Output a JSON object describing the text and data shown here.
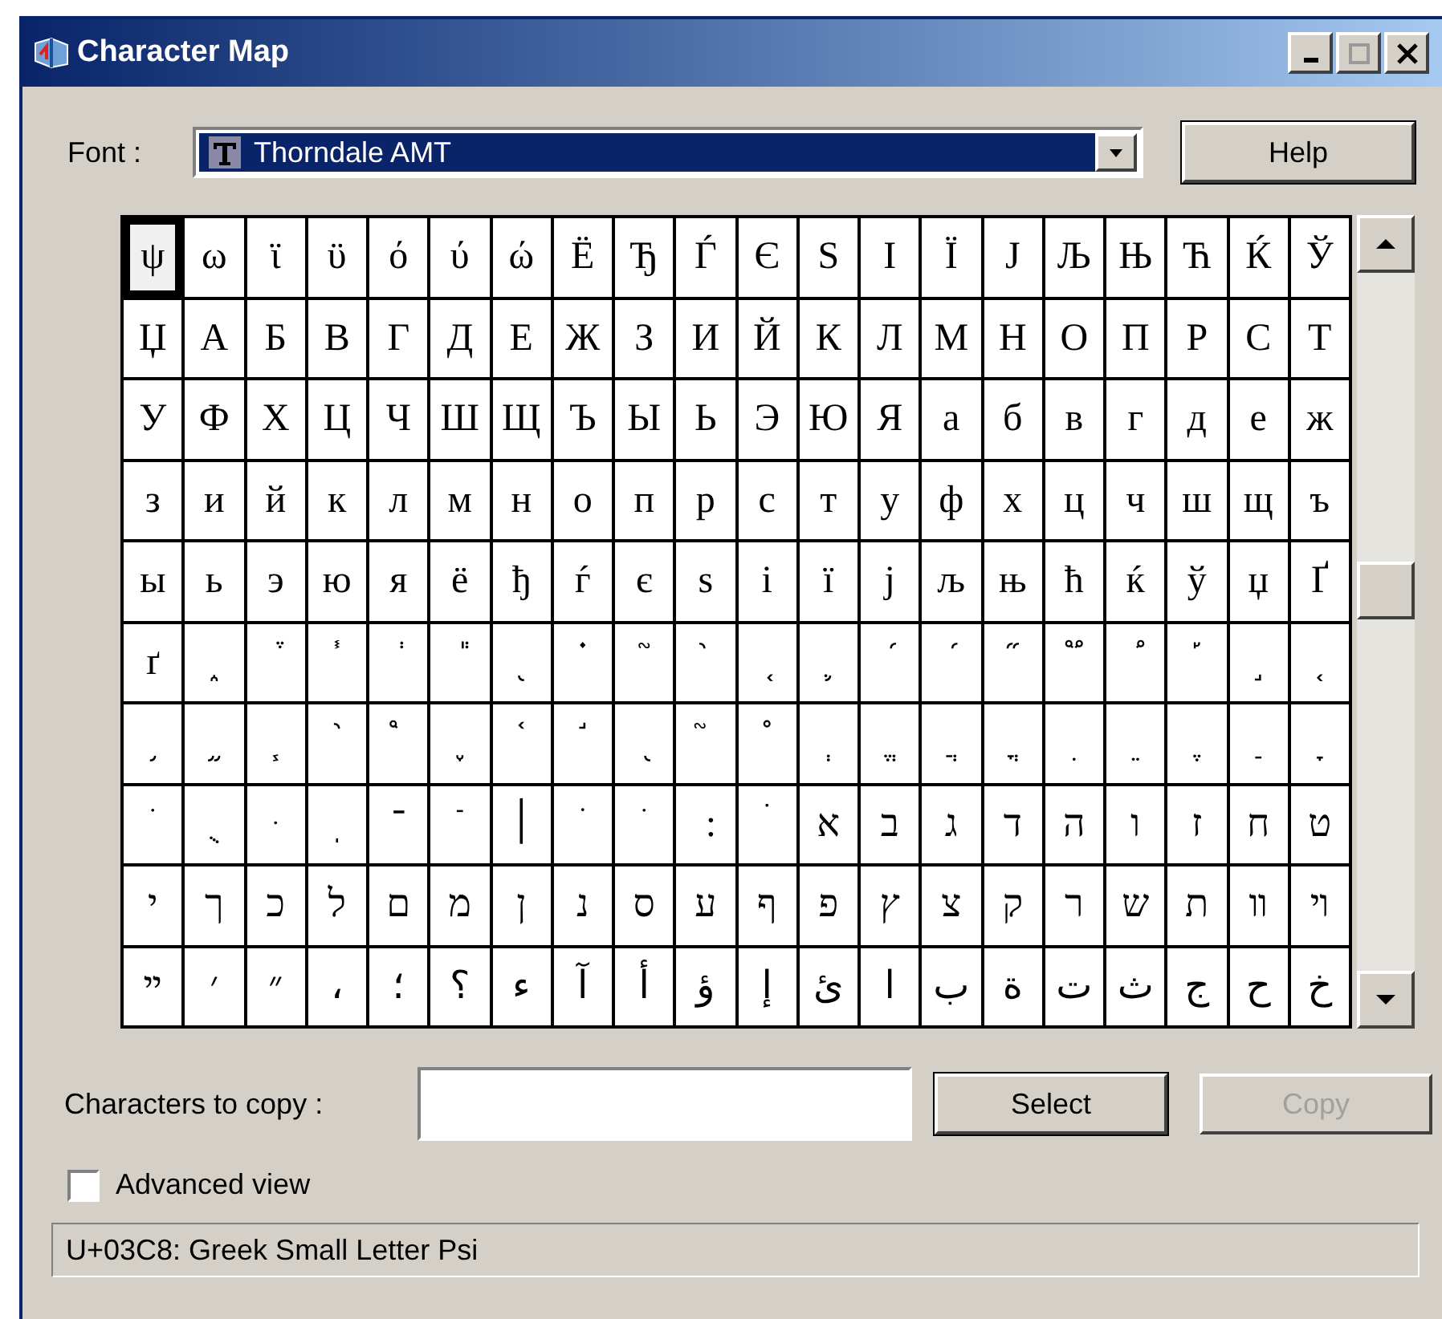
{
  "window": {
    "title": "Character Map"
  },
  "font": {
    "label": "Font :",
    "value": "Thorndale AMT"
  },
  "help_button": {
    "label": "Help"
  },
  "grid": {
    "rows": [
      {
        "cells": [
          {
            "char": "ψ",
            "selected": true
          },
          {
            "char": "ω",
            "selected": false
          },
          {
            "char": "ϊ",
            "selected": false
          },
          {
            "char": "ϋ",
            "selected": false
          },
          {
            "char": "ό",
            "selected": false
          },
          {
            "char": "ύ",
            "selected": false
          },
          {
            "char": "ώ",
            "selected": false
          },
          {
            "char": "Ё",
            "selected": false
          },
          {
            "char": "Ђ",
            "selected": false
          },
          {
            "char": "Ѓ",
            "selected": false
          },
          {
            "char": "Є",
            "selected": false
          },
          {
            "char": "Ѕ",
            "selected": false
          },
          {
            "char": "І",
            "selected": false
          },
          {
            "char": "Ї",
            "selected": false
          },
          {
            "char": "Ј",
            "selected": false
          },
          {
            "char": "Љ",
            "selected": false
          },
          {
            "char": "Њ",
            "selected": false
          },
          {
            "char": "Ћ",
            "selected": false
          },
          {
            "char": "Ќ",
            "selected": false
          },
          {
            "char": "Ў",
            "selected": false
          }
        ]
      },
      {
        "cells": [
          {
            "char": "Џ",
            "selected": false
          },
          {
            "char": "А",
            "selected": false
          },
          {
            "char": "Б",
            "selected": false
          },
          {
            "char": "В",
            "selected": false
          },
          {
            "char": "Г",
            "selected": false
          },
          {
            "char": "Д",
            "selected": false
          },
          {
            "char": "Е",
            "selected": false
          },
          {
            "char": "Ж",
            "selected": false
          },
          {
            "char": "З",
            "selected": false
          },
          {
            "char": "И",
            "selected": false
          },
          {
            "char": "Й",
            "selected": false
          },
          {
            "char": "К",
            "selected": false
          },
          {
            "char": "Л",
            "selected": false
          },
          {
            "char": "М",
            "selected": false
          },
          {
            "char": "Н",
            "selected": false
          },
          {
            "char": "О",
            "selected": false
          },
          {
            "char": "П",
            "selected": false
          },
          {
            "char": "Р",
            "selected": false
          },
          {
            "char": "С",
            "selected": false
          },
          {
            "char": "Т",
            "selected": false
          }
        ]
      },
      {
        "cells": [
          {
            "char": "У",
            "selected": false
          },
          {
            "char": "Ф",
            "selected": false
          },
          {
            "char": "Х",
            "selected": false
          },
          {
            "char": "Ц",
            "selected": false
          },
          {
            "char": "Ч",
            "selected": false
          },
          {
            "char": "Ш",
            "selected": false
          },
          {
            "char": "Щ",
            "selected": false
          },
          {
            "char": "Ъ",
            "selected": false
          },
          {
            "char": "Ы",
            "selected": false
          },
          {
            "char": "Ь",
            "selected": false
          },
          {
            "char": "Э",
            "selected": false
          },
          {
            "char": "Ю",
            "selected": false
          },
          {
            "char": "Я",
            "selected": false
          },
          {
            "char": "а",
            "selected": false
          },
          {
            "char": "б",
            "selected": false
          },
          {
            "char": "в",
            "selected": false
          },
          {
            "char": "г",
            "selected": false
          },
          {
            "char": "д",
            "selected": false
          },
          {
            "char": "е",
            "selected": false
          },
          {
            "char": "ж",
            "selected": false
          }
        ]
      },
      {
        "cells": [
          {
            "char": "з",
            "selected": false
          },
          {
            "char": "и",
            "selected": false
          },
          {
            "char": "й",
            "selected": false
          },
          {
            "char": "к",
            "selected": false
          },
          {
            "char": "л",
            "selected": false
          },
          {
            "char": "м",
            "selected": false
          },
          {
            "char": "н",
            "selected": false
          },
          {
            "char": "о",
            "selected": false
          },
          {
            "char": "п",
            "selected": false
          },
          {
            "char": "р",
            "selected": false
          },
          {
            "char": "с",
            "selected": false
          },
          {
            "char": "т",
            "selected": false
          },
          {
            "char": "у",
            "selected": false
          },
          {
            "char": "ф",
            "selected": false
          },
          {
            "char": "х",
            "selected": false
          },
          {
            "char": "ц",
            "selected": false
          },
          {
            "char": "ч",
            "selected": false
          },
          {
            "char": "ш",
            "selected": false
          },
          {
            "char": "щ",
            "selected": false
          },
          {
            "char": "ъ",
            "selected": false
          }
        ]
      },
      {
        "cells": [
          {
            "char": "ы",
            "selected": false
          },
          {
            "char": "ь",
            "selected": false
          },
          {
            "char": "э",
            "selected": false
          },
          {
            "char": "ю",
            "selected": false
          },
          {
            "char": "я",
            "selected": false
          },
          {
            "char": "ё",
            "selected": false
          },
          {
            "char": "ђ",
            "selected": false
          },
          {
            "char": "ѓ",
            "selected": false
          },
          {
            "char": "є",
            "selected": false
          },
          {
            "char": "ѕ",
            "selected": false
          },
          {
            "char": "і",
            "selected": false
          },
          {
            "char": "ї",
            "selected": false
          },
          {
            "char": "ј",
            "selected": false
          },
          {
            "char": "љ",
            "selected": false
          },
          {
            "char": "њ",
            "selected": false
          },
          {
            "char": "ћ",
            "selected": false
          },
          {
            "char": "ќ",
            "selected": false
          },
          {
            "char": "ў",
            "selected": false
          },
          {
            "char": "џ",
            "selected": false
          },
          {
            "char": "Ґ",
            "selected": false
          }
        ]
      },
      {
        "cells": [
          {
            "char": "ґ",
            "selected": false
          },
          {
            "char": "֑",
            "selected": false
          },
          {
            "char": "֒",
            "selected": false
          },
          {
            "char": "֓",
            "selected": false
          },
          {
            "char": "֔",
            "selected": false
          },
          {
            "char": "֕",
            "selected": false
          },
          {
            "char": "֖",
            "selected": false
          },
          {
            "char": "֗",
            "selected": false
          },
          {
            "char": "֘",
            "selected": false
          },
          {
            "char": "֙",
            "selected": false
          },
          {
            "char": "֚",
            "selected": false
          },
          {
            "char": "֛",
            "selected": false
          },
          {
            "char": "֜",
            "selected": false
          },
          {
            "char": "֝",
            "selected": false
          },
          {
            "char": "֞",
            "selected": false
          },
          {
            "char": "֟",
            "selected": false
          },
          {
            "char": "֠",
            "selected": false
          },
          {
            "char": "֡",
            "selected": false
          },
          {
            "char": "֣",
            "selected": false
          },
          {
            "char": "֤",
            "selected": false
          }
        ]
      },
      {
        "cells": [
          {
            "char": "֥",
            "selected": false
          },
          {
            "char": "֦",
            "selected": false
          },
          {
            "char": "֧",
            "selected": false
          },
          {
            "char": "֨",
            "selected": false
          },
          {
            "char": "֩",
            "selected": false
          },
          {
            "char": "֪",
            "selected": false
          },
          {
            "char": "֫",
            "selected": false
          },
          {
            "char": "֬",
            "selected": false
          },
          {
            "char": "֭",
            "selected": false
          },
          {
            "char": "֮",
            "selected": false
          },
          {
            "char": "֯",
            "selected": false
          },
          {
            "char": "ְ",
            "selected": false
          },
          {
            "char": "ֱ",
            "selected": false
          },
          {
            "char": "ֲ",
            "selected": false
          },
          {
            "char": "ֳ",
            "selected": false
          },
          {
            "char": "ִ",
            "selected": false
          },
          {
            "char": "ֵ",
            "selected": false
          },
          {
            "char": "ֶ",
            "selected": false
          },
          {
            "char": "ַ",
            "selected": false
          },
          {
            "char": "ָ",
            "selected": false
          }
        ]
      },
      {
        "cells": [
          {
            "char": "ֹ",
            "selected": false
          },
          {
            "char": "ֻ",
            "selected": false
          },
          {
            "char": "ּ",
            "selected": false
          },
          {
            "char": "ֽ",
            "selected": false
          },
          {
            "char": "־",
            "selected": false
          },
          {
            "char": "ֿ",
            "selected": false
          },
          {
            "char": "׀",
            "selected": false
          },
          {
            "char": "ׁ",
            "selected": false
          },
          {
            "char": "ׂ",
            "selected": false
          },
          {
            "char": "׃",
            "selected": false
          },
          {
            "char": "ׄ",
            "selected": false
          },
          {
            "char": "א",
            "selected": false
          },
          {
            "char": "ב",
            "selected": false
          },
          {
            "char": "ג",
            "selected": false
          },
          {
            "char": "ד",
            "selected": false
          },
          {
            "char": "ה",
            "selected": false
          },
          {
            "char": "ו",
            "selected": false
          },
          {
            "char": "ז",
            "selected": false
          },
          {
            "char": "ח",
            "selected": false
          },
          {
            "char": "ט",
            "selected": false
          }
        ]
      },
      {
        "cells": [
          {
            "char": "י",
            "selected": false
          },
          {
            "char": "ך",
            "selected": false
          },
          {
            "char": "כ",
            "selected": false
          },
          {
            "char": "ל",
            "selected": false
          },
          {
            "char": "ם",
            "selected": false
          },
          {
            "char": "מ",
            "selected": false
          },
          {
            "char": "ן",
            "selected": false
          },
          {
            "char": "נ",
            "selected": false
          },
          {
            "char": "ס",
            "selected": false
          },
          {
            "char": "ע",
            "selected": false
          },
          {
            "char": "ף",
            "selected": false
          },
          {
            "char": "פ",
            "selected": false
          },
          {
            "char": "ץ",
            "selected": false
          },
          {
            "char": "צ",
            "selected": false
          },
          {
            "char": "ק",
            "selected": false
          },
          {
            "char": "ר",
            "selected": false
          },
          {
            "char": "ש",
            "selected": false
          },
          {
            "char": "ת",
            "selected": false
          },
          {
            "char": "װ",
            "selected": false
          },
          {
            "char": "ױ",
            "selected": false
          }
        ]
      },
      {
        "cells": [
          {
            "char": "ײ",
            "selected": false
          },
          {
            "char": "׳",
            "selected": false
          },
          {
            "char": "״",
            "selected": false
          },
          {
            "char": "،",
            "selected": false
          },
          {
            "char": "؛",
            "selected": false
          },
          {
            "char": "؟",
            "selected": false
          },
          {
            "char": "ء",
            "selected": false
          },
          {
            "char": "آ",
            "selected": false
          },
          {
            "char": "أ",
            "selected": false
          },
          {
            "char": "ؤ",
            "selected": false
          },
          {
            "char": "إ",
            "selected": false
          },
          {
            "char": "ئ",
            "selected": false
          },
          {
            "char": "ا",
            "selected": false
          },
          {
            "char": "ب",
            "selected": false
          },
          {
            "char": "ة",
            "selected": false
          },
          {
            "char": "ت",
            "selected": false
          },
          {
            "char": "ث",
            "selected": false
          },
          {
            "char": "ج",
            "selected": false
          },
          {
            "char": "ح",
            "selected": false
          },
          {
            "char": "خ",
            "selected": false
          }
        ]
      }
    ]
  },
  "copy": {
    "label": "Characters to copy :"
  },
  "select_button": {
    "label": "Select",
    "disabled": false
  },
  "copy_button": {
    "label": "Copy",
    "disabled": true
  },
  "advanced_view": {
    "label": "Advanced view",
    "checked": false
  },
  "status_bar": {
    "text": "U+03C8: Greek Small Letter Psi"
  }
}
